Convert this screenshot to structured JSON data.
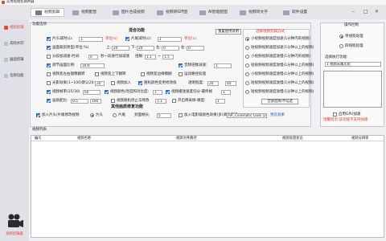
{
  "window": {
    "title": "实用视频剪辑神器"
  },
  "tabs": [
    {
      "label": "视频剪辑",
      "active": true
    },
    {
      "label": "视频配音"
    },
    {
      "label": "图片合成视频"
    },
    {
      "label": "视频转GIF图"
    },
    {
      "label": "AI智能配图"
    },
    {
      "label": "视频转文字"
    },
    {
      "label": "软件设置"
    }
  ],
  "sidebar": {
    "items": [
      {
        "label": "视频剪辑",
        "active": true
      },
      {
        "label": "去除水印"
      },
      {
        "label": "画面剪辑"
      },
      {
        "label": "音频功能"
      }
    ],
    "footer_label": "视频剪辑器"
  },
  "func": {
    "section_label": "功能选项",
    "combined_title": "混合功能",
    "reset_button": "重置使用说明",
    "row1": {
      "a_label": "片头减时(s):",
      "a_value": "1",
      "a_unit": "单位(s)",
      "b_label": "片尾减时(s):",
      "b_value": "1",
      "b_unit": "单位(s)"
    },
    "row2": {
      "label": "画面裁剪原型(单位:%)",
      "top_l": "上:",
      "top_v": "20",
      "bottom_l": "下:",
      "bottom_v": "20",
      "left_l": "左:",
      "left_v": "0",
      "right_l": "右:",
      "right_v": "0"
    },
    "row3": {
      "a_label": "分段加减速-时间:",
      "a_value": "0",
      "b_label": "秒一段进行加减速",
      "c_label": "倍数:",
      "c_min": "1.1",
      "c_sep": "~",
      "c_max": "1.5"
    },
    "row4": {
      "a_label": "调节画面比例:",
      "a_value": "16:9",
      "b_label": "音频倍数减速:",
      "b_value": "1"
    },
    "row5": {
      "a_label": "视频变左右镜像翻转",
      "b_label": "视频变上下翻转",
      "c_label": "视频变边缘模糊",
      "d_label": "运动路径处理"
    },
    "row6": {
      "a_label": "光影效果(1~100)默认20:",
      "a_value": "20",
      "b_label": "视频加入",
      "c_label": "随机颜色变更修改值",
      "d_label": "透明程度:",
      "d_min": "20",
      "d_max": "40"
    },
    "row7": {
      "a_label": "视频帧率(25/30)",
      "a_value": "60",
      "b_label": "视频颜色/亮度和对比度:",
      "b_value": "1",
      "c_label": "视频播放速度均分-最终帧",
      "c_value": "1"
    },
    "row8": {
      "a_label": "画质配比:",
      "a_value": "0.5",
      "a_value2": "100",
      "b_label": "视频随机停止与修改",
      "b_value": "1.1",
      "c_label": "开启降采样-精度:",
      "c_value": "1"
    }
  },
  "subtitle": {
    "title": "其他画质修复功能",
    "a_label": "加入片头/片尾修改视频",
    "a_radio1": "片头",
    "a_radio2": "片尾",
    "a_label2": "封面帧长:",
    "a_value": "5",
    "b_label": "加入电影级颜色效果(多)调色选择:",
    "b_value": "RA_Cinematic Look (23) cube",
    "b_link": "预览效果"
  },
  "options": {
    "title": "选择视频剪辑方式",
    "items": [
      "小视频视频速度加速(1分钟内的视频)",
      "短视频视频速度加速(1分钟以上的视频)",
      "小视频视频速度放慢(1分钟内的视频)",
      "短视频视频速度放慢(1分钟以上的视频)",
      "小视频视频速度放慢(1分钟以上的视频)",
      "短视频视频速度放慢(1分钟以上的视频)",
      "短视频视频速度放慢(1分钟以上的视频)"
    ],
    "select_all_button": "全部选择/不勾选"
  },
  "right": {
    "op_title": "操作控制",
    "radio1": "单线程处理",
    "radio2": "四线程处理",
    "select_label": "选择执行功能:",
    "select_value": "1 视频去尾次结",
    "gpu_label": "启用GPU加速",
    "warning": "温馨提示:该功能不支持加速",
    "btn_start": "",
    "btn_stop": ""
  },
  "list": {
    "title": "视频列表",
    "columns": [
      "编号",
      "视频名称",
      "视频文件路径",
      "视频处理状态",
      "视频分辨率"
    ]
  }
}
